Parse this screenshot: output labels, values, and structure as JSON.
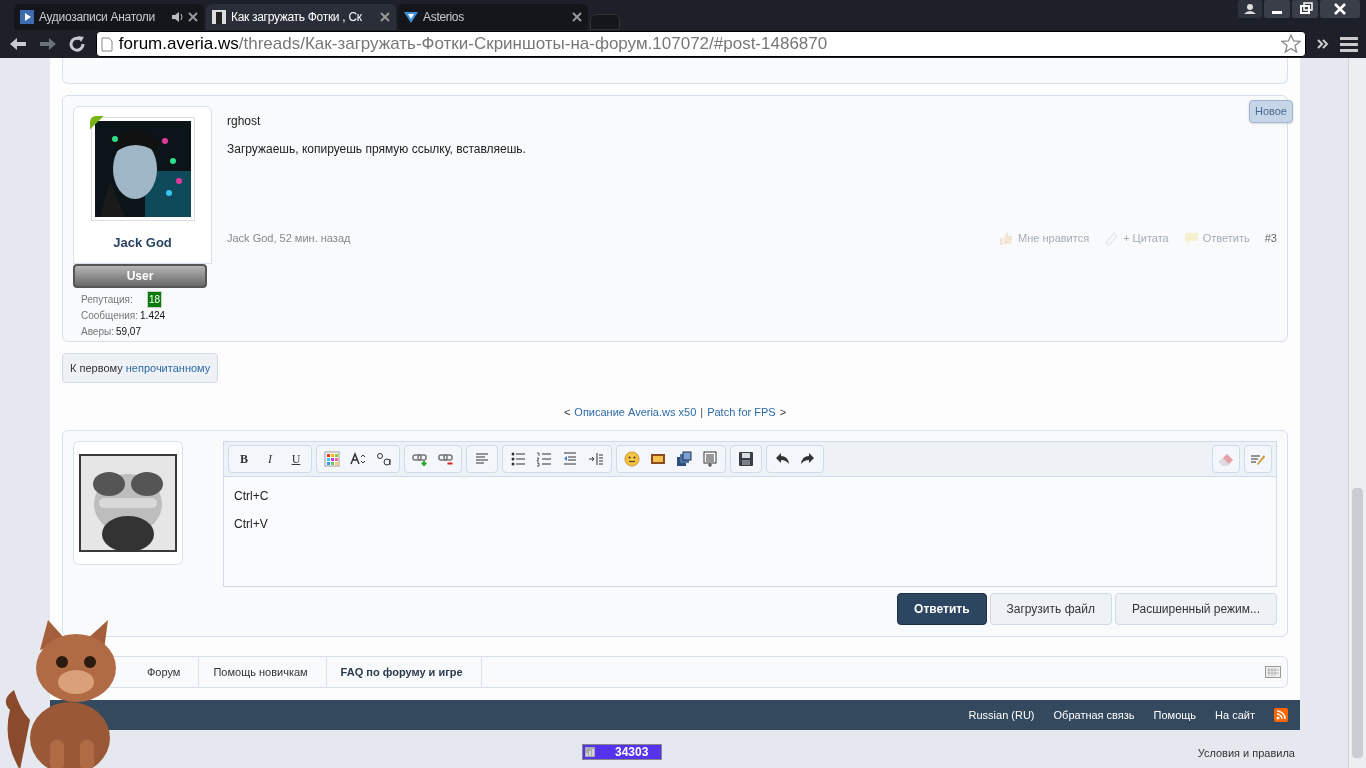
{
  "browser": {
    "tabs": [
      {
        "title": "Аудиозаписи Анатоли",
        "selected": false,
        "audio": true
      },
      {
        "title": "Как загружать Фотки , Ск",
        "selected": true,
        "audio": false
      },
      {
        "title": "Asterios",
        "selected": false,
        "audio": false
      }
    ],
    "url": {
      "domain": "forum.averia.ws",
      "path": "/threads/Как-загружать-Фотки-Скриншоты-на-форум.107072/#post-1486870"
    }
  },
  "post": {
    "author": "Jack God",
    "role": "User",
    "online": true,
    "stats": [
      {
        "label": "Репутация:",
        "value": "18",
        "kind": "badge"
      },
      {
        "label": "Сообщения:",
        "value": "1.424",
        "kind": "plain"
      },
      {
        "label": "Аверы:",
        "value": "59,07",
        "kind": "plain"
      }
    ],
    "lines": [
      "rghost",
      "Загружаешь, копируешь прямую ссылку, вставляешь."
    ],
    "meta": "Jack God, 52 мин. назад",
    "badge": "Новое",
    "actions": [
      "Мне нравится",
      "+ Цитата",
      "Ответить"
    ],
    "number": "#3"
  },
  "unread_button": {
    "prefix": "К первому",
    "link": "непрочитанному"
  },
  "thread_nav": {
    "prev_arrow": "<",
    "prev": "Описание Averia.ws x50",
    "separator": "|",
    "next": "Patch for FPS",
    "next_arrow": ">"
  },
  "editor": {
    "format_buttons": [
      "B",
      "I",
      "U"
    ],
    "lines": [
      "Ctrl+C",
      "Ctrl+V"
    ],
    "buttons": [
      {
        "label": "Ответить",
        "kind": "primary"
      },
      {
        "label": "Загрузить файл",
        "kind": "secondary"
      },
      {
        "label": "Расширенный режим...",
        "kind": "secondary"
      }
    ]
  },
  "breadcrumbs": [
    {
      "label": "Форум",
      "current": false
    },
    {
      "label": "Помощь новичкам",
      "current": false
    },
    {
      "label": "FAQ по форуму и игре",
      "current": true
    }
  ],
  "footer": {
    "links": [
      "Russian (RU)",
      "Обратная связь",
      "Помощь",
      "На сайт"
    ]
  },
  "counter": "34303",
  "terms": "Условия и правила"
}
